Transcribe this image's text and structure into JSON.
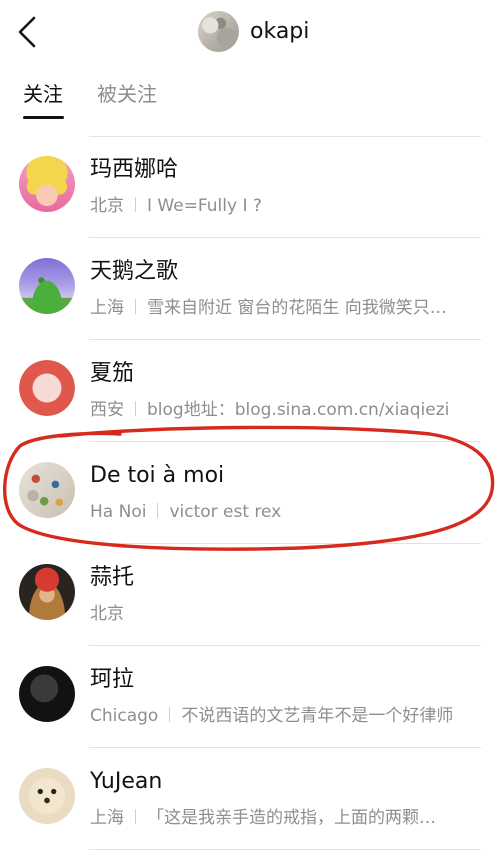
{
  "header": {
    "title": "okapi"
  },
  "tabs": [
    {
      "label": "关注",
      "active": true
    },
    {
      "label": "被关注",
      "active": false
    }
  ],
  "users": [
    {
      "name": "玛西娜哈",
      "city": "北京",
      "bio": "I We=Fully I ?"
    },
    {
      "name": "天鹅之歌",
      "city": "上海",
      "bio": "雪来自附近 窗台的花陌生 向我微笑只…"
    },
    {
      "name": "夏笳",
      "city": "西安",
      "bio": "blog地址：blog.sina.com.cn/xiaqiezi"
    },
    {
      "name": "De toi à moi",
      "city": "Ha Noi",
      "bio": "victor est rex"
    },
    {
      "name": "蒜托",
      "city": "北京",
      "bio": ""
    },
    {
      "name": "珂拉",
      "city": "Chicago",
      "bio": "不说西语的文艺青年不是一个好律师"
    },
    {
      "name": "YuJean",
      "city": "上海",
      "bio": "「这是我亲手造的戒指，上面的两颗…"
    }
  ],
  "colors": {
    "primary_text": "#111111",
    "secondary_text": "#8e8e8e",
    "divider": "#e2e2e2",
    "annotation": "#d62a1e"
  },
  "icons": {
    "back": "chevron-left-icon"
  }
}
